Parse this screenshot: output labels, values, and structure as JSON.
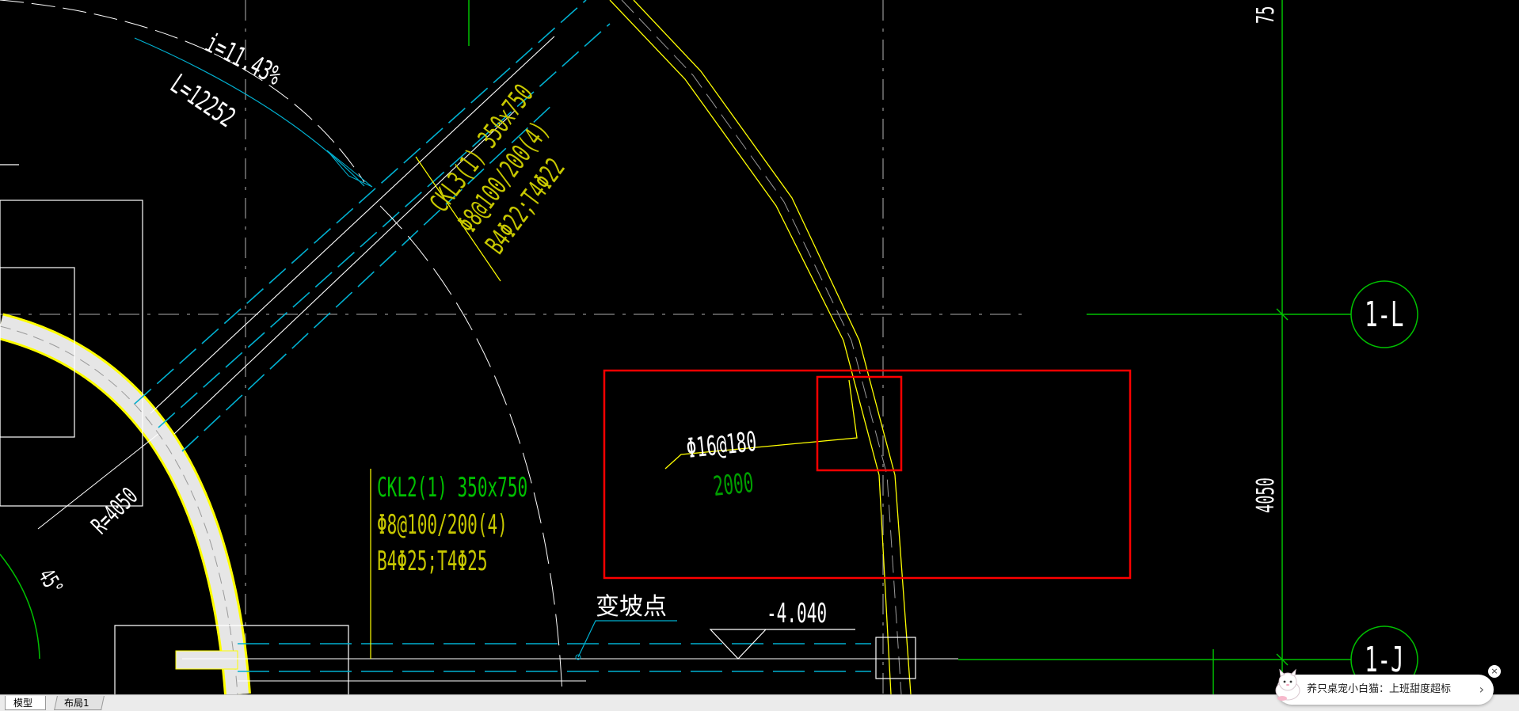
{
  "drawing": {
    "slope_text": "i=11.43%",
    "length_text": "L=12252",
    "beam3": {
      "name": "CKL3(1) 350x750",
      "stirrup": "Φ8@100/200(4)",
      "bars": "B4Φ22;T4Φ22"
    },
    "beam2": {
      "name": "CKL2(1) 350x750",
      "stirrup": "Φ8@100/200(4)",
      "bars": "B4Φ25;T4Φ25"
    },
    "radius_text": "R=4050",
    "angle_text": "45°",
    "rebar_spec": "Φ16@180",
    "rebar_length": "2000",
    "slope_change_text": "变坡点",
    "elevation_text": "-4.040",
    "dimension_text": "4050",
    "dimension_top_text": "75",
    "axis_1L": "1-L",
    "axis_1J": "1-J"
  },
  "colors": {
    "background": "#000000",
    "white": "#ffffff",
    "yellow": "#ffff00",
    "cad_green": "#00c000",
    "cyan": "#00b0d0",
    "red": "#ff0000",
    "gray": "#9a9a9a"
  },
  "tabs": {
    "model": "模型",
    "layout": "布局1"
  },
  "notification": {
    "text": "养只桌宠小白猫：上班甜度超标",
    "arrow": "›",
    "close": "×"
  }
}
